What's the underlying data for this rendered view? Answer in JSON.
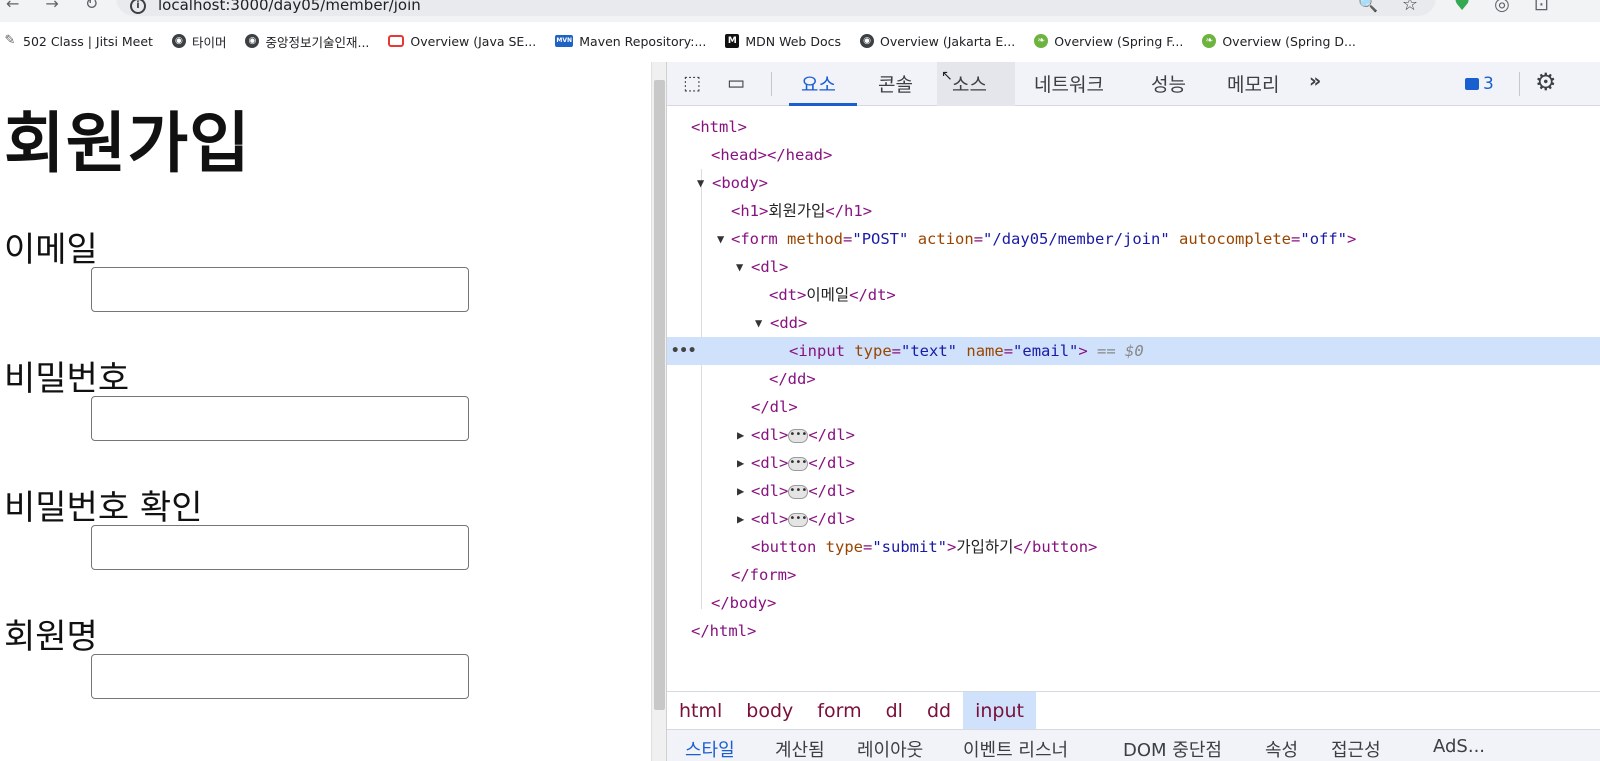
{
  "browser": {
    "url": "localhost:3000/day05/member/join",
    "bookmarks": [
      {
        "label": "502 Class | Jitsi Meet",
        "icon": "jitsi-icon"
      },
      {
        "label": "타이머",
        "icon": "globe-icon"
      },
      {
        "label": "중앙정보기술인재...",
        "icon": "globe-icon"
      },
      {
        "label": "Overview (Java SE...",
        "icon": "oracle-icon"
      },
      {
        "label": "Maven Repository:...",
        "icon": "maven-icon"
      },
      {
        "label": "MDN Web Docs",
        "icon": "mdn-icon"
      },
      {
        "label": "Overview (Jakarta E...",
        "icon": "globe-icon"
      },
      {
        "label": "Overview (Spring F...",
        "icon": "spring-icon"
      },
      {
        "label": "Overview (Spring D...",
        "icon": "spring-icon"
      }
    ]
  },
  "page": {
    "title": "회원가입",
    "fields": [
      {
        "label": "이메일",
        "value": ""
      },
      {
        "label": "비밀번호",
        "value": ""
      },
      {
        "label": "비밀번호 확인",
        "value": ""
      },
      {
        "label": "회원명",
        "value": ""
      }
    ]
  },
  "devtools": {
    "tabs": [
      "요소",
      "콘솔",
      "소스",
      "네트워크",
      "성능",
      "메모리"
    ],
    "active_tab": "요소",
    "more_tabs": "»",
    "issues_count": "3",
    "selected_suffix": "== $0",
    "dom": {
      "html_open": "<html>",
      "head": "<head></head>",
      "body_open": "<body>",
      "h1_open": "<h1>",
      "h1_text": "회원가입",
      "h1_close": "</h1>",
      "form_tag": "<form",
      "form_attr1": "method",
      "form_val1": "\"POST\"",
      "form_attr2": "action",
      "form_val2": "\"/day05/member/join\"",
      "form_attr3": "autocomplete",
      "form_val3": "\"off\"",
      "dl_open": "<dl>",
      "dt_open": "<dt>",
      "dt_text": "이메일",
      "dt_close": "</dt>",
      "dd_open": "<dd>",
      "input_tag": "<input",
      "input_attr1": "type",
      "input_val1": "\"text\"",
      "input_attr2": "name",
      "input_val2": "\"email\"",
      "dd_close": "</dd>",
      "dl_close": "</dl>",
      "button_tag": "<button",
      "button_attr": "type",
      "button_val": "\"submit\"",
      "button_text": "가입하기",
      "button_close": "</button>",
      "form_close": "</form>",
      "body_close": "</body>",
      "html_close": "</html>"
    },
    "breadcrumb": [
      "html",
      "body",
      "form",
      "dl",
      "dd",
      "input"
    ],
    "bottom_tabs": [
      "스타일",
      "계산됨",
      "레이아웃",
      "이벤트 리스너",
      "DOM 중단점",
      "속성",
      "접근성",
      "AdS..."
    ]
  }
}
